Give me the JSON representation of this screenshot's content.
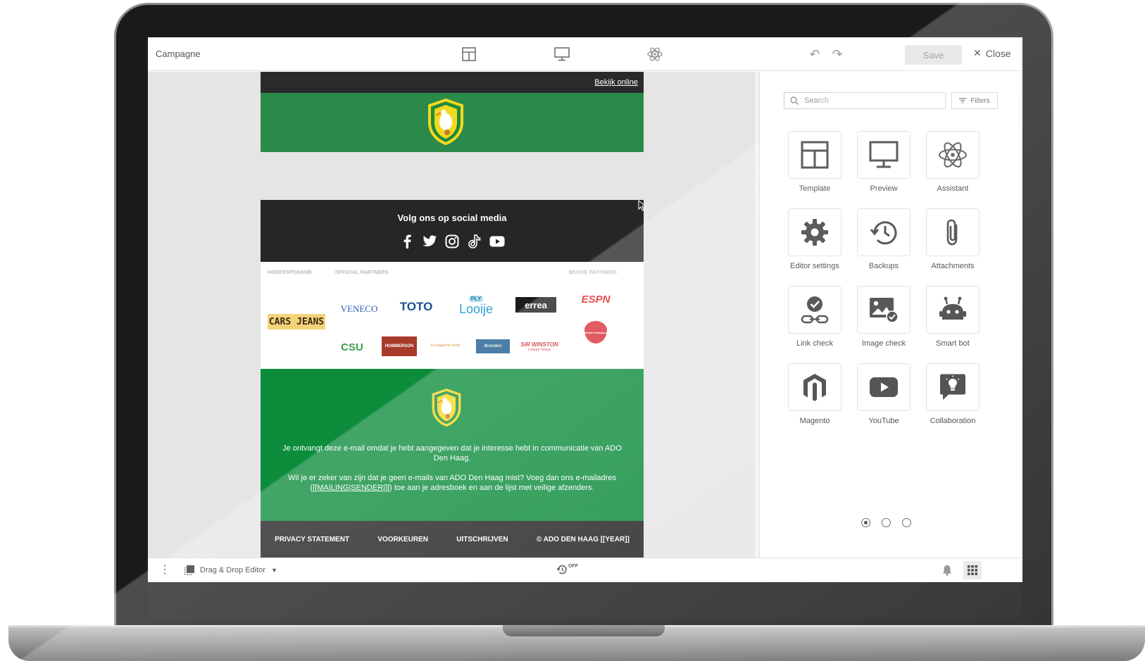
{
  "topbar": {
    "title": "Campagne",
    "save_label": "Save",
    "close_label": "Close",
    "icons": [
      "template-icon",
      "preview-icon",
      "assistant-icon",
      "undo-icon",
      "redo-icon"
    ]
  },
  "email": {
    "view_online": "Bekijk online",
    "social_title": "Volg ons op social media",
    "social_icons": [
      "facebook-icon",
      "twitter-icon",
      "instagram-icon",
      "tiktok-icon",
      "youtube-icon"
    ],
    "partner_labels": {
      "main": "HOOFDSPONSOR",
      "official": "OFFICIAL PARTNERS",
      "division": "DIVISIE PARTNERS"
    },
    "partner_logos": {
      "cars_jeans": "CARS JEANS",
      "veneco": "VENECO",
      "toto": "TOTO",
      "looije": "Looije",
      "looije_top": "PLY",
      "errea": "errea",
      "espn": "ESPN",
      "csu": "CSU",
      "hommerson": "HOMMERSON",
      "bouwfonds": "Ja Haagsche fonds",
      "branden": "Branden",
      "sir_winston": "SIR WINSTON",
      "sir_winston_sub": "Leisure Group",
      "houten": "Houten Kampeer"
    },
    "footer_text_1": "Je ontvangt deze e-mail omdat je hebt aangegeven dat je interesse hebt in communicatie van ADO Den Haag.",
    "footer_text_2_prefix": "Wil je er zeker van zijn dat je geen e-mails van ADO Den Haag mist? Voeg dan ons e-mailadres (",
    "footer_text_2_link": "[[MAILING|SENDER|]]",
    "footer_text_2_suffix": ") toe aan je adresboek en aan de lijst met veilige afzenders.",
    "bottom_links": [
      "PRIVACY STATEMENT",
      "VOORKEUREN",
      "UITSCHRIJVEN",
      "© ADO DEN HAAG [[YEAR]]"
    ],
    "colors": {
      "green": "#0d8c3c",
      "dark": "#262626",
      "yellow": "#f3d91e"
    }
  },
  "sidebar": {
    "search_placeholder": "Search",
    "filters_label": "Filters",
    "tiles": [
      {
        "label": "Template",
        "icon": "template-icon"
      },
      {
        "label": "Preview",
        "icon": "monitor-icon"
      },
      {
        "label": "Assistant",
        "icon": "atom-icon"
      },
      {
        "label": "Editor settings",
        "icon": "gear-icon"
      },
      {
        "label": "Backups",
        "icon": "history-icon"
      },
      {
        "label": "Attachments",
        "icon": "paperclip-icon"
      },
      {
        "label": "Link check",
        "icon": "link-check-icon"
      },
      {
        "label": "Image check",
        "icon": "image-check-icon"
      },
      {
        "label": "Smart bot",
        "icon": "robot-icon"
      },
      {
        "label": "Magento",
        "icon": "magento-icon"
      },
      {
        "label": "YouTube",
        "icon": "youtube-icon"
      },
      {
        "label": "Collaboration",
        "icon": "collaboration-icon"
      }
    ],
    "page_dots": 3,
    "active_page": 1
  },
  "bottombar": {
    "editor_label": "Drag & Drop Editor",
    "autosave_label": "OFF"
  }
}
